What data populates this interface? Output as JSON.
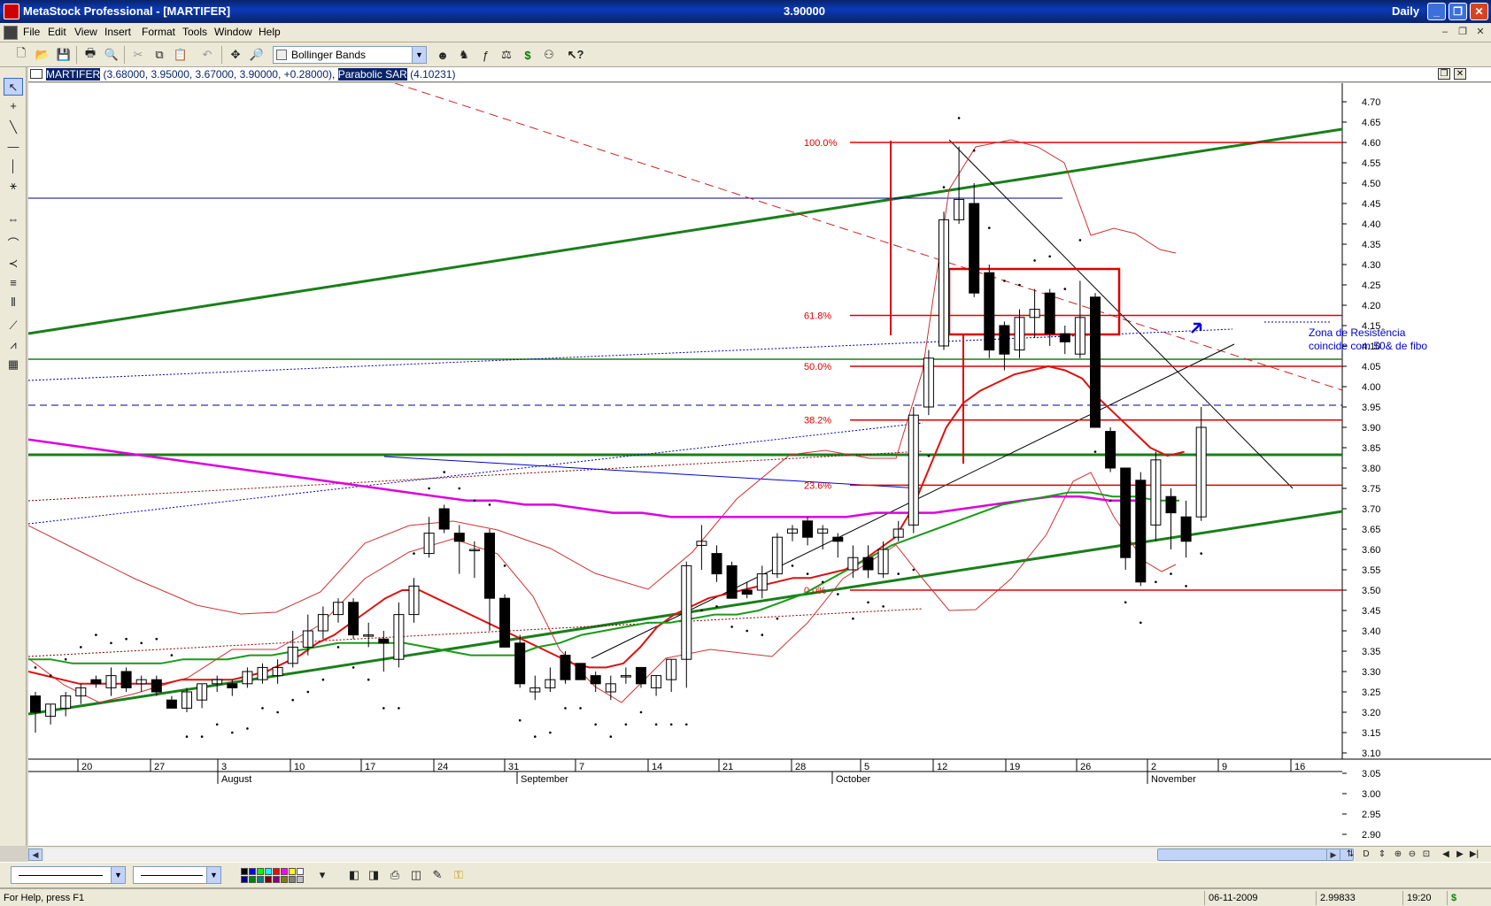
{
  "window": {
    "title": "MetaStock Professional - [MARTIFER]",
    "center_value": "3.90000",
    "period": "Daily"
  },
  "menu": [
    "File",
    "Edit",
    "View",
    "Insert",
    "Format",
    "Tools",
    "Window",
    "Help"
  ],
  "toolbar": {
    "indicator_selected": "Bollinger Bands",
    "indicator_icon": "line-chart-icon"
  },
  "chart_header": {
    "symbol": "MARTIFER",
    "ohlc": "(3.68000, 3.95000, 3.67000, 3.90000, +0.28000)",
    "indicator": "Parabolic SAR",
    "indicator_value": "(4.10231)"
  },
  "annotation": {
    "line1": "Zona de Resistência",
    "line2": "coincide com 50& de fibo"
  },
  "status": {
    "help": "For Help, press F1",
    "date": "06-11-2009",
    "value": "2.99833",
    "time": "19:20",
    "currency": "$"
  },
  "colors": {
    "title_bar": "#0a246a",
    "candle_up": "#ffffff",
    "candle_down": "#000000",
    "fib_red": "#dd0000",
    "trend_green": "#228b22",
    "ma_red": "#dd1111",
    "ma_green": "#1a9a1a",
    "magenta": "#dd00dd",
    "bollinger": "#cc2222",
    "annotation_blue": "#0000cc"
  },
  "chart_data": {
    "type": "candlestick",
    "y_axis": {
      "min": 2.9,
      "max": 4.7,
      "ticks": [
        "4.70",
        "4.65",
        "4.60",
        "4.55",
        "4.50",
        "4.45",
        "4.40",
        "4.35",
        "4.30",
        "4.25",
        "4.20",
        "4.15",
        "4.10",
        "4.05",
        "4.00",
        "3.95",
        "3.90",
        "3.85",
        "3.80",
        "3.75",
        "3.70",
        "3.65",
        "3.60",
        "3.55",
        "3.50",
        "3.45",
        "3.40",
        "3.35",
        "3.30",
        "3.25",
        "3.20",
        "3.15",
        "3.10",
        "3.05",
        "3.00",
        "2.95",
        "2.90"
      ]
    },
    "x_day_labels": [
      "20",
      "27",
      "3",
      "10",
      "17",
      "24",
      "31",
      "7",
      "14",
      "21",
      "28",
      "5",
      "12",
      "19",
      "26",
      "2",
      "9",
      "16"
    ],
    "x_month_labels": [
      "August",
      "September",
      "October",
      "November"
    ],
    "fib_levels": [
      {
        "label": "100.0%",
        "value": 4.6
      },
      {
        "label": "61.8%",
        "value": 4.175
      },
      {
        "label": "50.0%",
        "value": 4.05
      },
      {
        "label": "38.2%",
        "value": 3.918
      },
      {
        "label": "23.6%",
        "value": 3.758
      },
      {
        "label": "0.0%",
        "value": 3.5
      }
    ],
    "candles": [
      {
        "o": 3.24,
        "h": 3.25,
        "l": 3.15,
        "c": 3.2
      },
      {
        "o": 3.19,
        "h": 3.22,
        "l": 3.17,
        "c": 3.22
      },
      {
        "o": 3.21,
        "h": 3.25,
        "l": 3.19,
        "c": 3.24
      },
      {
        "o": 3.24,
        "h": 3.27,
        "l": 3.22,
        "c": 3.26
      },
      {
        "o": 3.28,
        "h": 3.29,
        "l": 3.26,
        "c": 3.27
      },
      {
        "o": 3.26,
        "h": 3.31,
        "l": 3.24,
        "c": 3.29
      },
      {
        "o": 3.3,
        "h": 3.31,
        "l": 3.25,
        "c": 3.26
      },
      {
        "o": 3.27,
        "h": 3.29,
        "l": 3.25,
        "c": 3.28
      },
      {
        "o": 3.28,
        "h": 3.29,
        "l": 3.24,
        "c": 3.25
      },
      {
        "o": 3.23,
        "h": 3.24,
        "l": 3.21,
        "c": 3.21
      },
      {
        "o": 3.21,
        "h": 3.26,
        "l": 3.2,
        "c": 3.25
      },
      {
        "o": 3.23,
        "h": 3.27,
        "l": 3.21,
        "c": 3.27
      },
      {
        "o": 3.27,
        "h": 3.29,
        "l": 3.25,
        "c": 3.28
      },
      {
        "o": 3.27,
        "h": 3.28,
        "l": 3.24,
        "c": 3.26
      },
      {
        "o": 3.27,
        "h": 3.31,
        "l": 3.26,
        "c": 3.3
      },
      {
        "o": 3.28,
        "h": 3.32,
        "l": 3.27,
        "c": 3.31
      },
      {
        "o": 3.29,
        "h": 3.33,
        "l": 3.27,
        "c": 3.31
      },
      {
        "o": 3.32,
        "h": 3.4,
        "l": 3.31,
        "c": 3.36
      },
      {
        "o": 3.36,
        "h": 3.44,
        "l": 3.34,
        "c": 3.4
      },
      {
        "o": 3.4,
        "h": 3.46,
        "l": 3.38,
        "c": 3.44
      },
      {
        "o": 3.44,
        "h": 3.48,
        "l": 3.42,
        "c": 3.47
      },
      {
        "o": 3.47,
        "h": 3.48,
        "l": 3.38,
        "c": 3.39
      },
      {
        "o": 3.39,
        "h": 3.42,
        "l": 3.36,
        "c": 3.39
      },
      {
        "o": 3.38,
        "h": 3.4,
        "l": 3.3,
        "c": 3.37
      },
      {
        "o": 3.33,
        "h": 3.47,
        "l": 3.31,
        "c": 3.44
      },
      {
        "o": 3.44,
        "h": 3.53,
        "l": 3.42,
        "c": 3.51
      },
      {
        "o": 3.59,
        "h": 3.68,
        "l": 3.58,
        "c": 3.64
      },
      {
        "o": 3.7,
        "h": 3.71,
        "l": 3.64,
        "c": 3.65
      },
      {
        "o": 3.64,
        "h": 3.66,
        "l": 3.54,
        "c": 3.62
      },
      {
        "o": 3.6,
        "h": 3.62,
        "l": 3.53,
        "c": 3.6
      },
      {
        "o": 3.64,
        "h": 3.65,
        "l": 3.4,
        "c": 3.48
      },
      {
        "o": 3.48,
        "h": 3.49,
        "l": 3.36,
        "c": 3.36
      },
      {
        "o": 3.37,
        "h": 3.39,
        "l": 3.26,
        "c": 3.27
      },
      {
        "o": 3.25,
        "h": 3.29,
        "l": 3.23,
        "c": 3.26
      },
      {
        "o": 3.26,
        "h": 3.31,
        "l": 3.25,
        "c": 3.28
      },
      {
        "o": 3.34,
        "h": 3.35,
        "l": 3.27,
        "c": 3.28
      },
      {
        "o": 3.32,
        "h": 3.32,
        "l": 3.28,
        "c": 3.28
      },
      {
        "o": 3.29,
        "h": 3.3,
        "l": 3.25,
        "c": 3.27
      },
      {
        "o": 3.25,
        "h": 3.29,
        "l": 3.23,
        "c": 3.27
      },
      {
        "o": 3.29,
        "h": 3.31,
        "l": 3.27,
        "c": 3.29
      },
      {
        "o": 3.31,
        "h": 3.31,
        "l": 3.26,
        "c": 3.27
      },
      {
        "o": 3.26,
        "h": 3.29,
        "l": 3.24,
        "c": 3.29
      },
      {
        "o": 3.28,
        "h": 3.33,
        "l": 3.25,
        "c": 3.33
      },
      {
        "o": 3.33,
        "h": 3.57,
        "l": 3.26,
        "c": 3.56
      },
      {
        "o": 3.61,
        "h": 3.66,
        "l": 3.55,
        "c": 3.62
      },
      {
        "o": 3.59,
        "h": 3.61,
        "l": 3.52,
        "c": 3.54
      },
      {
        "o": 3.56,
        "h": 3.57,
        "l": 3.48,
        "c": 3.48
      },
      {
        "o": 3.5,
        "h": 3.52,
        "l": 3.48,
        "c": 3.49
      },
      {
        "o": 3.5,
        "h": 3.56,
        "l": 3.48,
        "c": 3.54
      },
      {
        "o": 3.54,
        "h": 3.64,
        "l": 3.53,
        "c": 3.63
      },
      {
        "o": 3.64,
        "h": 3.66,
        "l": 3.62,
        "c": 3.65
      },
      {
        "o": 3.67,
        "h": 3.68,
        "l": 3.61,
        "c": 3.63
      },
      {
        "o": 3.64,
        "h": 3.66,
        "l": 3.6,
        "c": 3.65
      },
      {
        "o": 3.63,
        "h": 3.64,
        "l": 3.58,
        "c": 3.62
      },
      {
        "o": 3.55,
        "h": 3.61,
        "l": 3.53,
        "c": 3.58
      },
      {
        "o": 3.58,
        "h": 3.61,
        "l": 3.53,
        "c": 3.55
      },
      {
        "o": 3.54,
        "h": 3.62,
        "l": 3.53,
        "c": 3.6
      },
      {
        "o": 3.63,
        "h": 3.67,
        "l": 3.62,
        "c": 3.65
      },
      {
        "o": 3.66,
        "h": 3.95,
        "l": 3.64,
        "c": 3.93
      },
      {
        "o": 3.95,
        "h": 4.09,
        "l": 3.93,
        "c": 4.07
      },
      {
        "o": 4.1,
        "h": 4.43,
        "l": 4.09,
        "c": 4.41
      },
      {
        "o": 4.41,
        "h": 4.59,
        "l": 4.4,
        "c": 4.46
      },
      {
        "o": 4.45,
        "h": 4.5,
        "l": 4.22,
        "c": 4.23
      },
      {
        "o": 4.28,
        "h": 4.3,
        "l": 4.07,
        "c": 4.09
      },
      {
        "o": 4.15,
        "h": 4.16,
        "l": 4.04,
        "c": 4.08
      },
      {
        "o": 4.09,
        "h": 4.19,
        "l": 4.07,
        "c": 4.17
      },
      {
        "o": 4.17,
        "h": 4.24,
        "l": 4.12,
        "c": 4.19
      },
      {
        "o": 4.23,
        "h": 4.24,
        "l": 4.1,
        "c": 4.13
      },
      {
        "o": 4.13,
        "h": 4.15,
        "l": 4.08,
        "c": 4.11
      },
      {
        "o": 4.08,
        "h": 4.26,
        "l": 4.07,
        "c": 4.17
      },
      {
        "o": 4.22,
        "h": 4.23,
        "l": 3.9,
        "c": 3.9
      },
      {
        "o": 3.89,
        "h": 3.9,
        "l": 3.79,
        "c": 3.8
      },
      {
        "o": 3.8,
        "h": 3.8,
        "l": 3.55,
        "c": 3.58
      },
      {
        "o": 3.77,
        "h": 3.79,
        "l": 3.51,
        "c": 3.52
      },
      {
        "o": 3.66,
        "h": 3.84,
        "l": 3.62,
        "c": 3.82
      },
      {
        "o": 3.73,
        "h": 3.75,
        "l": 3.6,
        "c": 3.69
      },
      {
        "o": 3.68,
        "h": 3.72,
        "l": 3.58,
        "c": 3.62
      },
      {
        "o": 3.68,
        "h": 3.95,
        "l": 3.67,
        "c": 3.9
      }
    ],
    "ma_red": [
      3.3,
      3.29,
      3.28,
      3.27,
      3.27,
      3.27,
      3.27,
      3.27,
      3.27,
      3.28,
      3.28,
      3.28,
      3.28,
      3.29,
      3.3,
      3.32,
      3.34,
      3.37,
      3.39,
      3.42,
      3.45,
      3.48,
      3.5,
      3.5,
      3.48,
      3.46,
      3.44,
      3.42,
      3.4,
      3.38,
      3.36,
      3.34,
      3.32,
      3.31,
      3.31,
      3.32,
      3.36,
      3.41,
      3.44,
      3.46,
      3.48,
      3.49,
      3.5,
      3.51,
      3.52,
      3.53,
      3.53,
      3.54,
      3.55,
      3.57,
      3.6,
      3.63,
      3.7,
      3.8,
      3.9,
      3.96,
      3.99,
      4.01,
      4.03,
      4.04,
      4.05,
      4.04,
      4.02,
      3.97,
      3.93,
      3.89,
      3.85,
      3.83,
      3.84
    ],
    "ma_green": [
      3.33,
      3.33,
      3.32,
      3.32,
      3.32,
      3.32,
      3.32,
      3.33,
      3.33,
      3.33,
      3.34,
      3.34,
      3.35,
      3.36,
      3.37,
      3.37,
      3.37,
      3.37,
      3.36,
      3.35,
      3.34,
      3.34,
      3.34,
      3.36,
      3.37,
      3.39,
      3.4,
      3.41,
      3.42,
      3.42,
      3.43,
      3.44,
      3.44,
      3.45,
      3.47,
      3.49,
      3.52,
      3.55,
      3.58,
      3.61,
      3.63,
      3.65,
      3.67,
      3.69,
      3.71,
      3.72,
      3.73,
      3.74,
      3.74,
      3.73,
      3.73,
      3.72,
      3.72
    ],
    "magenta": [
      3.87,
      3.86,
      3.85,
      3.84,
      3.83,
      3.82,
      3.81,
      3.8,
      3.79,
      3.78,
      3.77,
      3.76,
      3.75,
      3.74,
      3.73,
      3.72,
      3.72,
      3.71,
      3.71,
      3.7,
      3.69,
      3.69,
      3.68,
      3.68,
      3.68,
      3.68,
      3.68,
      3.68,
      3.68,
      3.69,
      3.69,
      3.69,
      3.7,
      3.71,
      3.72,
      3.73,
      3.73,
      3.72,
      3.72
    ]
  }
}
